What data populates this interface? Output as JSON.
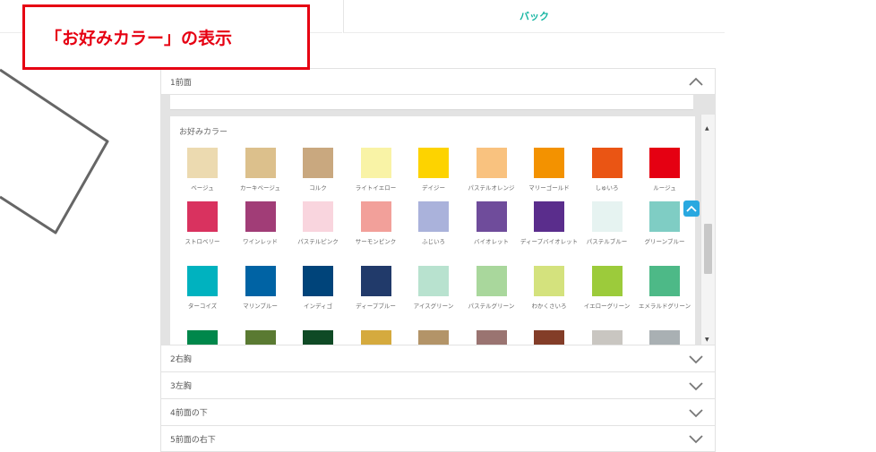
{
  "tabs": {
    "back_label": "バック"
  },
  "callout": {
    "text": "「お好みカラー」の表示"
  },
  "sections": [
    {
      "label": "1前面",
      "state": "expanded"
    },
    {
      "label": "2右胸",
      "state": "collapsed"
    },
    {
      "label": "3左胸",
      "state": "collapsed"
    },
    {
      "label": "4前面の下",
      "state": "collapsed"
    },
    {
      "label": "5前面の右下",
      "state": "collapsed"
    }
  ],
  "color_panel": {
    "title": "お好みカラー",
    "colors": [
      {
        "name": "ベージュ",
        "hex": "#ecdab0"
      },
      {
        "name": "カーキベージュ",
        "hex": "#dcc08c"
      },
      {
        "name": "コルク",
        "hex": "#c9a87f"
      },
      {
        "name": "ライトイエロー",
        "hex": "#f9f3a6"
      },
      {
        "name": "デイジー",
        "hex": "#fdd300"
      },
      {
        "name": "パステルオレンジ",
        "hex": "#f9c27f"
      },
      {
        "name": "マリーゴールド",
        "hex": "#f39200"
      },
      {
        "name": "しゅいろ",
        "hex": "#ea5514"
      },
      {
        "name": "ルージュ",
        "hex": "#e50012"
      },
      {
        "name": "ストロベリー",
        "hex": "#d9325f"
      },
      {
        "name": "ワインレッド",
        "hex": "#a13d77"
      },
      {
        "name": "パステルピンク",
        "hex": "#f9d5de"
      },
      {
        "name": "サーモンピンク",
        "hex": "#f2a09a"
      },
      {
        "name": "ふじいろ",
        "hex": "#aab2db"
      },
      {
        "name": "バイオレット",
        "hex": "#6f4c9b"
      },
      {
        "name": "ディープバイオレット",
        "hex": "#5a2d8c"
      },
      {
        "name": "パステルブルー",
        "hex": "#e6f3f1"
      },
      {
        "name": "グリーンブルー",
        "hex": "#7fcdc4"
      },
      {
        "name": "ターコイズ",
        "hex": "#00b2bf"
      },
      {
        "name": "マリンブルー",
        "hex": "#0063a4"
      },
      {
        "name": "インディゴ",
        "hex": "#00447a"
      },
      {
        "name": "ディープブルー",
        "hex": "#213a6a"
      },
      {
        "name": "アイスグリーン",
        "hex": "#b8e2cf"
      },
      {
        "name": "パステルグリーン",
        "hex": "#a9d79c"
      },
      {
        "name": "わかくさいろ",
        "hex": "#d4e27d"
      },
      {
        "name": "イエローグリーン",
        "hex": "#9ccb3b"
      },
      {
        "name": "エメラルドグリーン",
        "hex": "#4db987"
      },
      {
        "name": "",
        "hex": "#00874b"
      },
      {
        "name": "",
        "hex": "#5a7a32"
      },
      {
        "name": "",
        "hex": "#0f4a25"
      },
      {
        "name": "",
        "hex": "#d5aa3e"
      },
      {
        "name": "",
        "hex": "#b39468"
      },
      {
        "name": "",
        "hex": "#9a7471"
      },
      {
        "name": "",
        "hex": "#833d28"
      },
      {
        "name": "",
        "hex": "#c9c6c1"
      },
      {
        "name": "",
        "hex": "#a9b0b3"
      }
    ]
  },
  "colors_ui": {
    "accent": "#18b6a3",
    "callout_red": "#e60012",
    "back_to_top": "#29a8e0"
  },
  "icons": {
    "expanded": "chevron-up-icon",
    "collapsed": "chevron-down-icon",
    "back_to_top": "chevron-up-icon"
  }
}
